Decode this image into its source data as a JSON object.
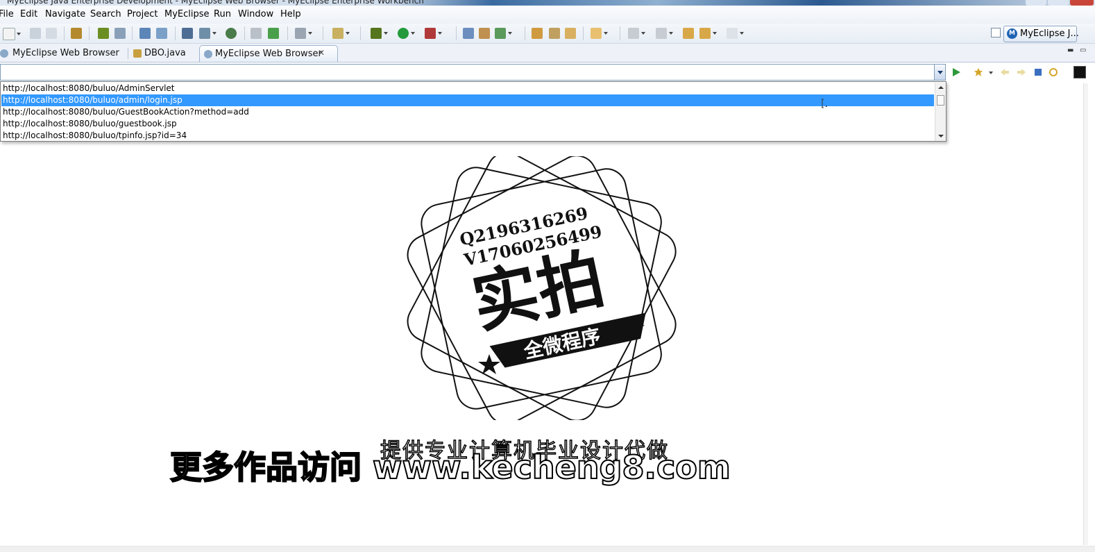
{
  "window": {
    "title": "MyEclipse Java Enterprise Development - MyEclipse Web Browser - MyEclipse Enterprise Workbench"
  },
  "menu": {
    "items": [
      "File",
      "Edit",
      "Navigate",
      "Search",
      "Project",
      "MyEclipse",
      "Run",
      "Window",
      "Help"
    ]
  },
  "perspective": {
    "label": "MyEclipse J..."
  },
  "tabs": [
    {
      "label": "MyEclipse Web Browser",
      "icon": "globe-icon",
      "active": false
    },
    {
      "label": "DBO.java",
      "icon": "java-file-icon",
      "active": false
    },
    {
      "label": "MyEclipse Web Browser",
      "icon": "globe-icon",
      "active": true,
      "close": "✕"
    }
  ],
  "browser": {
    "url_value": "",
    "suggestions": [
      "http://localhost:8080/buluo/AdminServlet",
      "http://localhost:8080/buluo/admin/login.jsp",
      "http://localhost:8080/buluo/GuestBookAction?method=add",
      "http://localhost:8080/buluo/guestbook.jsp",
      "http://localhost:8080/buluo/tpinfo.jsp?id=34"
    ],
    "selected_index": 1
  },
  "watermark": {
    "contact_q": "Q2196316269",
    "contact_v": "V17060256499",
    "main": "实拍",
    "banner": "全微程序",
    "line1": "提供专业计算机毕业设计代做",
    "line2": "更多作品访问 www.kecheng8.com"
  },
  "colors": {
    "selection": "#3399ff",
    "tab_border": "#9fb3cf",
    "toolbar_bg": "#e7edf5"
  }
}
